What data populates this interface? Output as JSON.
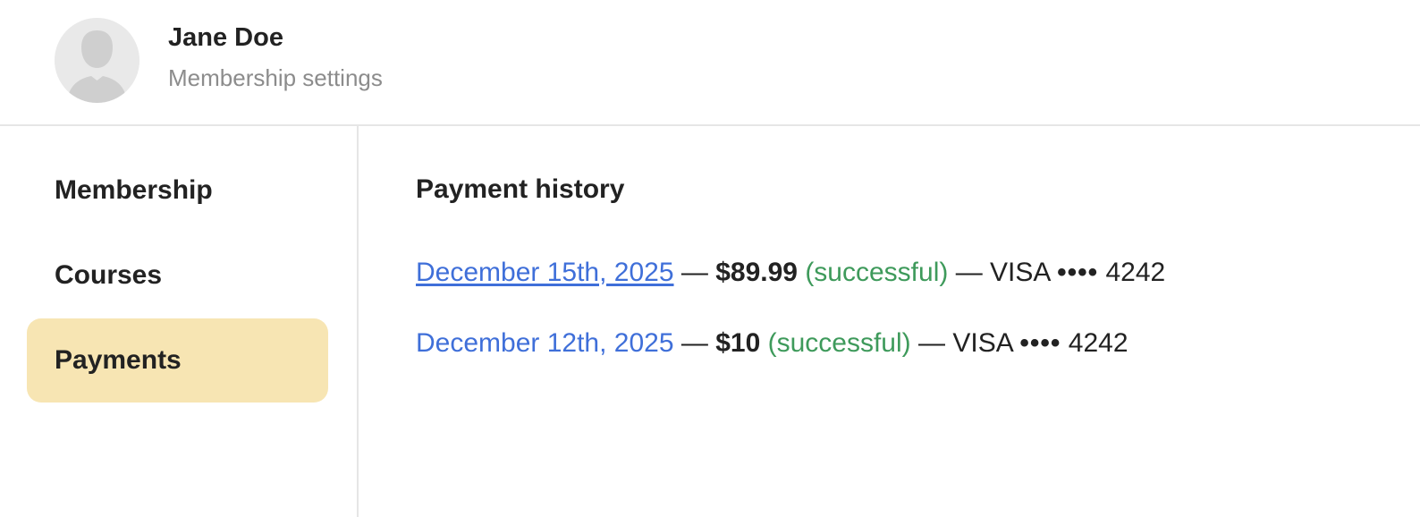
{
  "header": {
    "user_name": "Jane Doe",
    "subtitle": "Membership settings",
    "avatar_icon": "user-avatar-icon"
  },
  "sidebar": {
    "items": [
      {
        "label": "Membership",
        "active": false
      },
      {
        "label": "Courses",
        "active": false
      },
      {
        "label": "Payments",
        "active": true
      }
    ]
  },
  "main": {
    "title": "Payment history",
    "payments": [
      {
        "date": "December 15th, 2025",
        "separator": "—",
        "amount": "$89.99",
        "status": "(successful)",
        "card_brand": "VISA",
        "card_mask": "••••",
        "card_last4": "4242"
      },
      {
        "date": "December 12th, 2025",
        "separator": "—",
        "amount": "$10",
        "status": "(successful)",
        "card_brand": "VISA",
        "card_mask": "••••",
        "card_last4": "4242"
      }
    ]
  },
  "colors": {
    "active_nav_bg": "#f7e5b3",
    "link": "#3f6fd9",
    "success": "#3e9a5b",
    "muted": "#8c8c8c"
  }
}
